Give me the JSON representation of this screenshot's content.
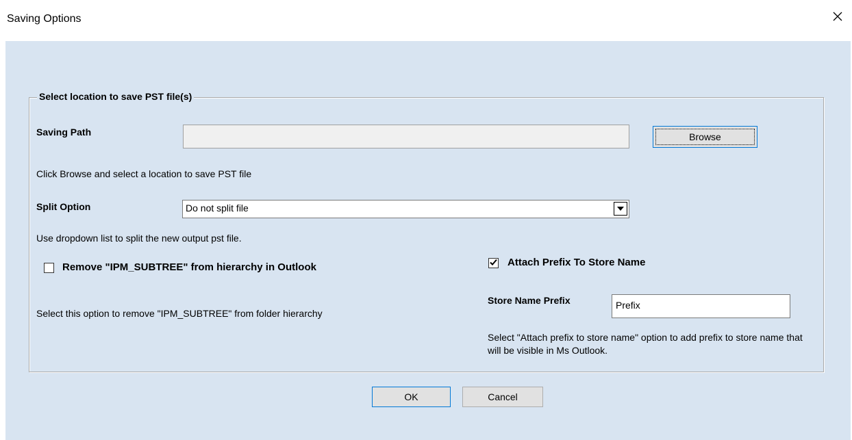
{
  "window": {
    "title": "Saving Options",
    "close_icon": "close-icon"
  },
  "group": {
    "legend": "Select location to save PST file(s)"
  },
  "saving_path": {
    "label": "Saving Path",
    "value": "",
    "browse_label": "Browse",
    "hint": "Click Browse and select a location to save PST file"
  },
  "split": {
    "label": "Split Option",
    "selected": "Do not split file",
    "hint": "Use dropdown list to split the new output pst file."
  },
  "remove_ipm": {
    "label": "Remove \"IPM_SUBTREE\" from hierarchy in Outlook",
    "checked": false,
    "hint": "Select this option to remove \"IPM_SUBTREE\" from folder hierarchy"
  },
  "attach_prefix": {
    "label": "Attach Prefix To Store Name",
    "checked": true,
    "prefix_label": "Store Name Prefix",
    "prefix_value": "Prefix",
    "hint": "Select \"Attach prefix to store name\" option to add prefix to store name that will be visible in Ms Outlook."
  },
  "buttons": {
    "ok_label": "OK",
    "cancel_label": "Cancel"
  },
  "colors": {
    "client_background": "#d8e4f1",
    "focus_border": "#0078d7"
  }
}
